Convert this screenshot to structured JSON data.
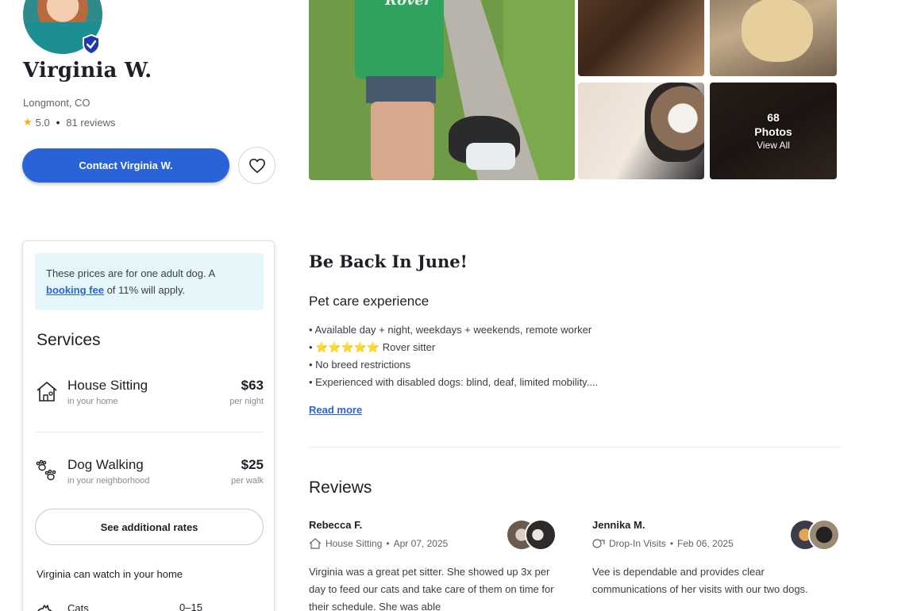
{
  "profile": {
    "name": "Virginia W.",
    "location": "Longmont, CO",
    "rating": "5.0",
    "review_count": "81 reviews",
    "contact_label": "Contact Virginia W."
  },
  "gallery": {
    "photo_count": "68",
    "photos_label": "Photos",
    "view_all_label": "View All",
    "shirt_brand": "Rover"
  },
  "pricing": {
    "note_prefix": "These prices are for one adult dog. A",
    "note_link": "booking fee",
    "note_suffix": "of 11% will apply."
  },
  "services": {
    "title": "Services",
    "items": [
      {
        "name": "House Sitting",
        "subtitle": "in your home",
        "price": "$63",
        "unit": "per night",
        "icon": "house-sitting-icon"
      },
      {
        "name": "Dog Walking",
        "subtitle": "in your neighborhood",
        "price": "$25",
        "unit": "per walk",
        "icon": "paw-prints-icon"
      }
    ],
    "additional_rates_label": "See additional rates",
    "watch_title": "Virginia can watch in your home",
    "pets": [
      {
        "name": "Cats",
        "value": "0–15",
        "icon": "cat-icon"
      }
    ]
  },
  "about": {
    "title": "Be Back In June!",
    "experience_title": "Pet care experience",
    "bullets": [
      "• Available day + night, weekdays + weekends, remote worker",
      "• ",
      "• No breed restrictions",
      "• Experienced with disabled dogs: blind, deaf, limited mobility...."
    ],
    "stars_text": "⭐⭐⭐⭐⭐",
    "rover_sitter_text": " Rover sitter",
    "read_more": "Read more"
  },
  "reviews": {
    "title": "Reviews",
    "items": [
      {
        "name": "Rebecca F.",
        "service": "House Sitting",
        "date": "Apr 07, 2025",
        "body": "Virginia was a great pet sitter. She showed up 3x per day to feed our cats and take care of them on time for their schedule. She was able",
        "icon": "house-sitting-icon"
      },
      {
        "name": "Jennika M.",
        "service": "Drop-In Visits",
        "date": "Feb 06, 2025",
        "body": "Vee is dependable and provides clear communications of her visits with our two dogs.",
        "icon": "drop-in-icon"
      }
    ]
  },
  "colors": {
    "primary": "#2a62d7",
    "price_note_bg": "#e6f7fb",
    "star": "#f4b400",
    "text": "#1f1f26",
    "muted": "#62626c"
  }
}
